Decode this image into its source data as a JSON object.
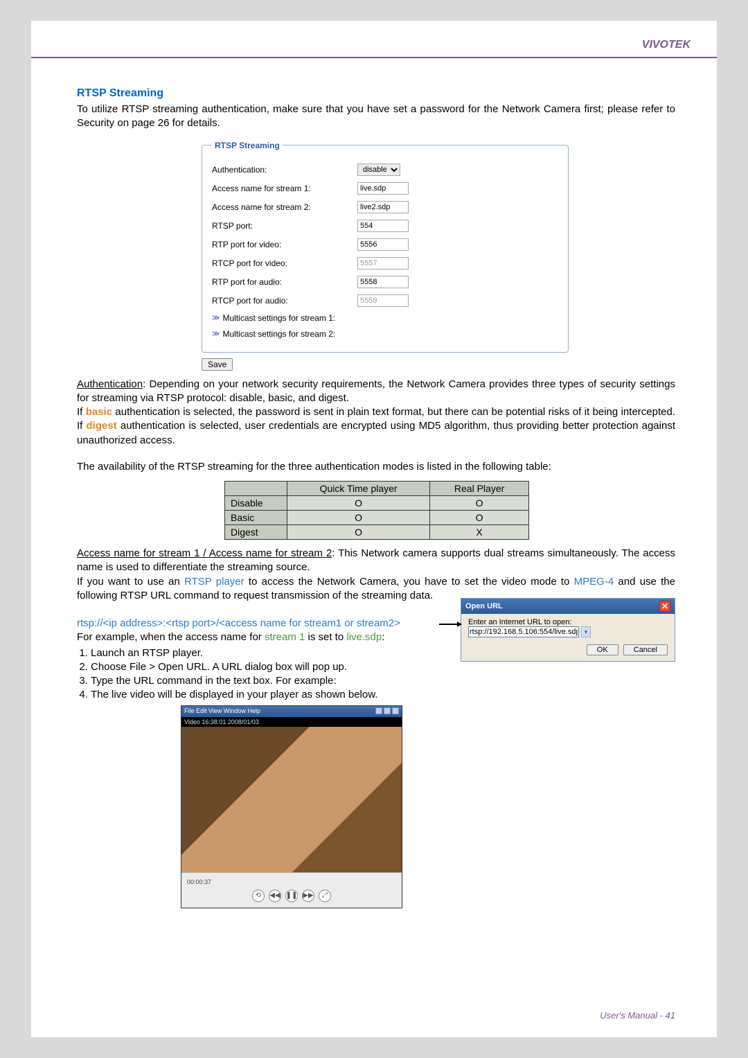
{
  "header": {
    "brand": "VIVOTEK"
  },
  "section": {
    "title": "RTSP Streaming",
    "intro": "To utilize RTSP streaming authentication, make sure that you have set a password for the Network Camera first; please refer to Security on page 26 for details."
  },
  "form": {
    "legend": "RTSP Streaming",
    "rows": {
      "auth": {
        "label": "Authentication:",
        "value": "disable"
      },
      "s1name": {
        "label": "Access name for stream 1:",
        "value": "live.sdp"
      },
      "s2name": {
        "label": "Access name for stream 2:",
        "value": "live2.sdp"
      },
      "rtsp_port": {
        "label": "RTSP port:",
        "value": "554"
      },
      "rtp_video": {
        "label": "RTP port for video:",
        "value": "5556"
      },
      "rtcp_video": {
        "label": "RTCP port for video:",
        "value": "5557"
      },
      "rtp_audio": {
        "label": "RTP port for audio:",
        "value": "5558"
      },
      "rtcp_audio": {
        "label": "RTCP port for audio:",
        "value": "5559"
      },
      "mc1": "Multicast settings for stream 1:",
      "mc2": "Multicast settings for stream 2:"
    },
    "save": "Save"
  },
  "auth_para": {
    "lead": "Authentication",
    "p1": ": Depending on your network security requirements, the Network Camera provides three types of security settings for streaming via RTSP protocol: disable, basic, and digest.",
    "p2a": "If ",
    "basic": "basic",
    "p2b": " authentication is selected, the password is sent in plain text format, but there can be potential risks of it being intercepted. If ",
    "digest": "digest",
    "p2c": " authentication is selected, user credentials are encrypted using MD5 algorithm, thus providing better protection against unauthorized access."
  },
  "table": {
    "caption": "The availability of the RTSP streaming for the three authentication modes is listed in the following table:",
    "headers": {
      "col1": "",
      "col2": "Quick Time player",
      "col3": "Real Player"
    },
    "rows": [
      {
        "name": "Disable",
        "qt": "O",
        "rp": "O"
      },
      {
        "name": "Basic",
        "qt": "O",
        "rp": "O"
      },
      {
        "name": "Digest",
        "qt": "O",
        "rp": "X"
      }
    ]
  },
  "access": {
    "lead": "Access name for stream 1 / Access name for stream 2",
    "p1": ": This Network camera supports dual streams simultaneously. The access name is used to differentiate the streaming source.",
    "p2a": "If you want to use an ",
    "rtsp": "RTSP player",
    "p2b": " to access the Network Camera, you have to set the video mode to ",
    "mpeg4": "MPEG-4",
    "p2c": " and use the following RTSP URL command to request transmission of the streaming data."
  },
  "url_example": {
    "pattern": "rtsp://<ip address>:<rtsp port>/<access name for stream1 or stream2>",
    "ex_lead": "For example, when the access name for ",
    "stream1": "stream 1",
    "ex_mid": " is set to ",
    "sdp": "live.sdp",
    "colon": ":"
  },
  "steps": {
    "s1": "Launch an RTSP player.",
    "s2": "Choose File > Open URL. A URL dialog box will pop up.",
    "s3": "Type the URL command in the text box. For example:",
    "s4": "The live video will be displayed in your player as shown below."
  },
  "dialog": {
    "title": "Open URL",
    "label": "Enter an Internet URL to open:",
    "value": "rtsp://192.168.5.106:554/live.sdp",
    "ok": "OK",
    "cancel": "Cancel"
  },
  "player": {
    "menu": "File  Edit  View  Window  Help",
    "caption": "Video 16:38:01 2008/01/03",
    "time_left": "00:00:37",
    "icons": [
      "⟲",
      "◀◀",
      "❚❚",
      "▶▶",
      "⤢"
    ]
  },
  "footer": {
    "text": "User's Manual - 41"
  }
}
